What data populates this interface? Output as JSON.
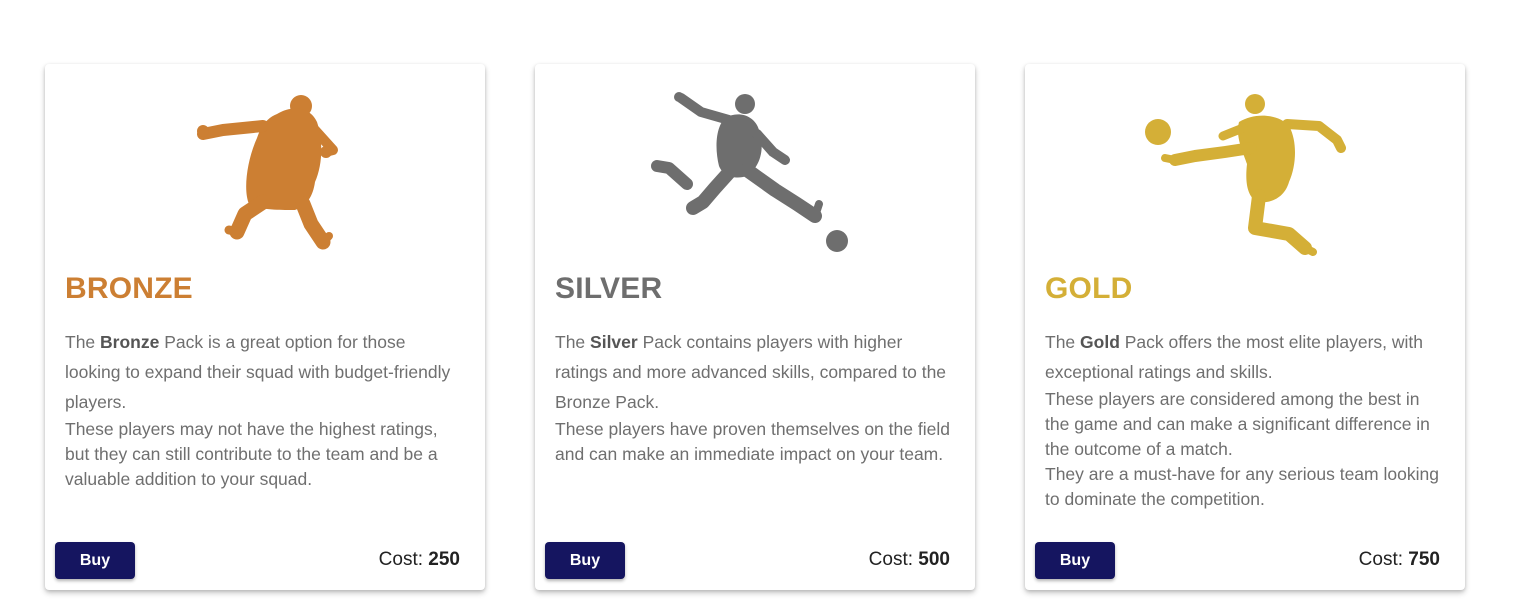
{
  "colors": {
    "bronze": "#cc7f33",
    "silver": "#6e6e6e",
    "gold": "#d4af37",
    "buy_button": "#151560"
  },
  "packs": [
    {
      "icon": "bronze-player-silhouette-icon",
      "title": "BRONZE",
      "desc_prefix": "The ",
      "desc_bold": "Bronze",
      "desc_rest": " Pack is a great option for those looking to expand their squad with budget-friendly players.",
      "desc_more": [
        "These players may not have the highest ratings, but they can still contribute to the team and be a valuable addition to your squad."
      ],
      "buy_label": "Buy",
      "cost_label": "Cost: ",
      "cost_value": "250"
    },
    {
      "icon": "silver-player-silhouette-icon",
      "title": "SILVER",
      "desc_prefix": "The ",
      "desc_bold": "Silver",
      "desc_rest": " Pack contains players with higher ratings and more advanced skills, compared to the Bronze Pack.",
      "desc_more": [
        "These players have proven themselves on the field and can make an immediate impact on your team."
      ],
      "buy_label": "Buy",
      "cost_label": "Cost: ",
      "cost_value": "500"
    },
    {
      "icon": "gold-player-silhouette-icon",
      "title": "GOLD",
      "desc_prefix": "The ",
      "desc_bold": "Gold",
      "desc_rest": " Pack offers the most elite players, with exceptional ratings and skills.",
      "desc_more": [
        "These players are considered among the best in the game and can make a significant difference in the outcome of a match.",
        "They are a must-have for any serious team looking to dominate the competition."
      ],
      "buy_label": "Buy",
      "cost_label": "Cost: ",
      "cost_value": "750"
    }
  ]
}
